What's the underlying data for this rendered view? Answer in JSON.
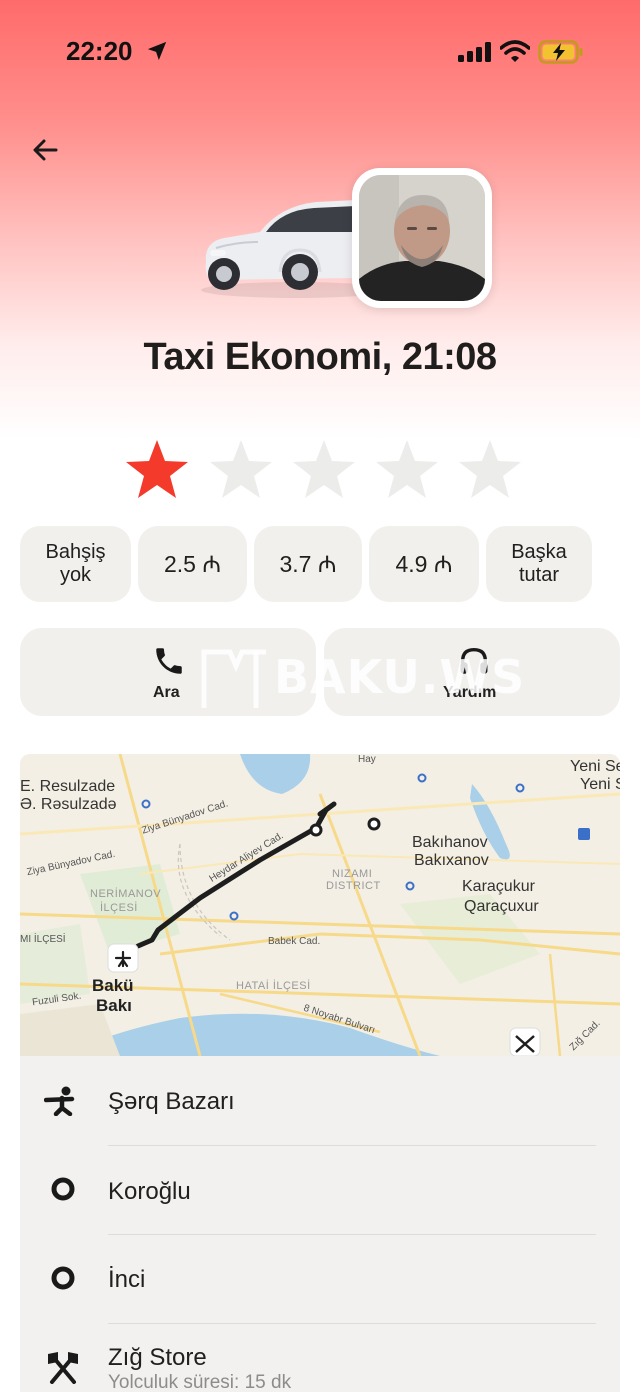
{
  "status_bar": {
    "time": "22:20"
  },
  "order": {
    "title": "Taxi Ekonomi, 21:08"
  },
  "rating": {
    "value": 1,
    "max": 5,
    "active_color": "#f33a2b",
    "inactive_color": "#ececea"
  },
  "tips": [
    {
      "line1": "Bahşiş",
      "line2": "yok"
    },
    {
      "line1": "2.5 ₼"
    },
    {
      "line1": "3.7 ₼"
    },
    {
      "line1": "4.9 ₼"
    },
    {
      "line1": "Başka",
      "line2": "tutar"
    }
  ],
  "actions": {
    "call_label": "Ara",
    "help_label": "Yardım"
  },
  "watermark": "BAKU.WS",
  "map": {
    "labels": {
      "l1": "E. Resulzade",
      "l2": "Ə. Rəsulzadə",
      "l3": "Ziya Bünyadov Cad.",
      "l4": "Ziya Bünyadov Cad.",
      "l5": "NERİMANOV",
      "l6": "İLÇESİ",
      "l7": "Heydar Aliyev Cad.",
      "l8": "NIZAMI",
      "l9": "DISTRICT",
      "l10": "Bakıhanov",
      "l11": "Bakıxanov",
      "l12": "Karaçukur",
      "l13": "Qaraçuxur",
      "l14": "Yeni Se",
      "l15": "Yeni Se",
      "l16": "Babek Cad.",
      "l17": "HATAİ İLÇESİ",
      "l18": "8 Noyabr Bulvarı",
      "l19": "Bakü",
      "l20": "Bakı",
      "l21": "Fuzuli Sok.",
      "l22": "Zığ Cad.",
      "l23": "MI İLÇESİ",
      "l24": "Hay"
    }
  },
  "route": {
    "stops": [
      {
        "name": "Şərq Bazarı",
        "icon": "pedestrian-icon"
      },
      {
        "name": "Koroğlu",
        "icon": "circle-stop-icon"
      },
      {
        "name": "İnci",
        "icon": "circle-stop-icon"
      },
      {
        "name": "Zığ Store",
        "icon": "finish-flag-icon",
        "subtitle": "Yolculuk süresi: 15 dk"
      }
    ]
  }
}
